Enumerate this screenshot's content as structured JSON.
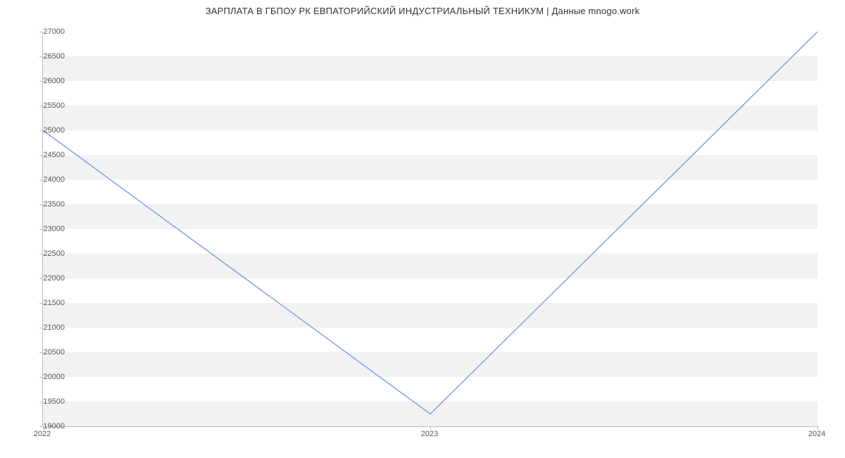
{
  "chart_data": {
    "type": "line",
    "title": "ЗАРПЛАТА В ГБПОУ РК ЕВПАТОРИЙСКИЙ ИНДУСТРИАЛЬНЫЙ ТЕХНИКУМ | Данные mnogo.work",
    "x": [
      2022,
      2023,
      2024
    ],
    "values": [
      25000,
      19250,
      27000
    ],
    "xlabel": "",
    "ylabel": "",
    "xlim": [
      2022,
      2024
    ],
    "ylim": [
      19000,
      27000
    ],
    "yticks": [
      19000,
      19500,
      20000,
      20500,
      21000,
      21500,
      22000,
      22500,
      23000,
      23500,
      24000,
      24500,
      25000,
      25500,
      26000,
      26500,
      27000
    ],
    "xticks": [
      2022,
      2023,
      2024
    ],
    "line_color": "#7a9ed9",
    "band_color": "#f2f2f2"
  }
}
